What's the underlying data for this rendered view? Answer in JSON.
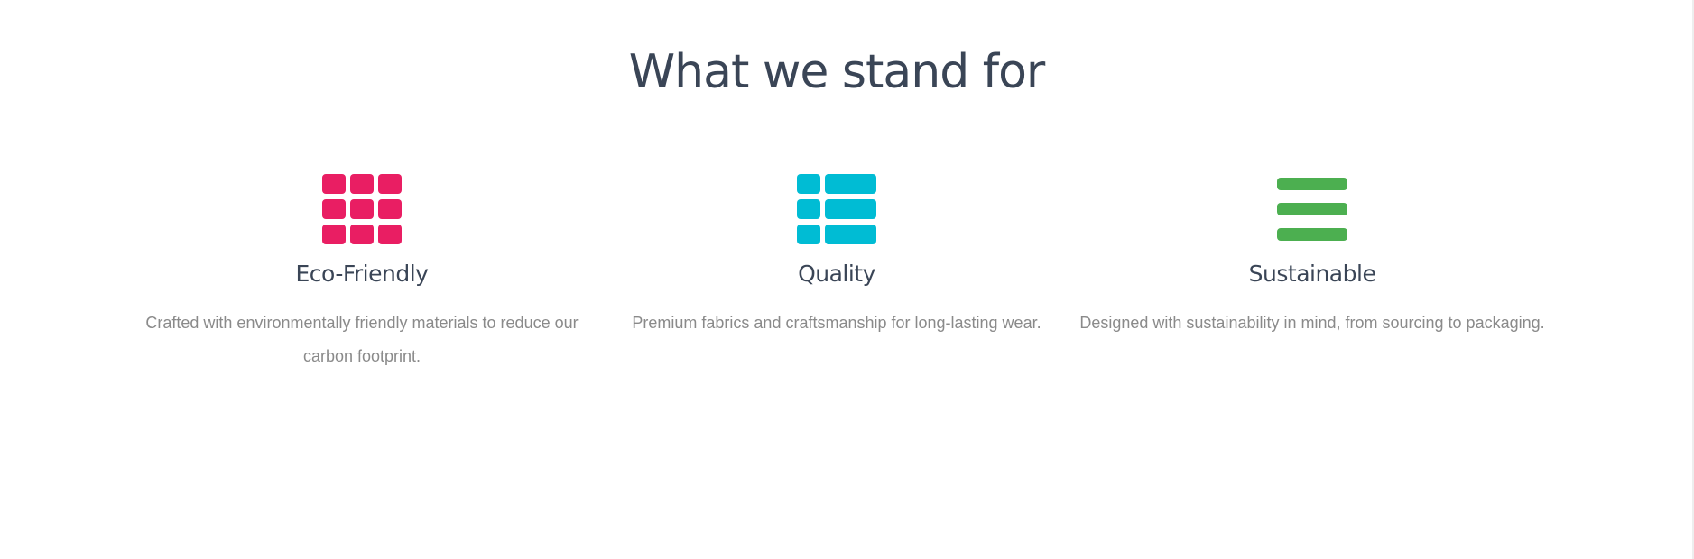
{
  "section": {
    "title": "What we stand for"
  },
  "features": [
    {
      "icon": "grid-icon",
      "color": "#e91e63",
      "title": "Eco-Friendly",
      "description": "Crafted with environmentally friendly materials to reduce our carbon footprint."
    },
    {
      "icon": "view-list-icon",
      "color": "#00bcd4",
      "title": "Quality",
      "description": "Premium fabrics and craftsmanship for long-lasting wear."
    },
    {
      "icon": "menu-icon",
      "color": "#4caf50",
      "title": "Sustainable",
      "description": "Designed with sustainability in mind, from sourcing to packaging."
    }
  ]
}
